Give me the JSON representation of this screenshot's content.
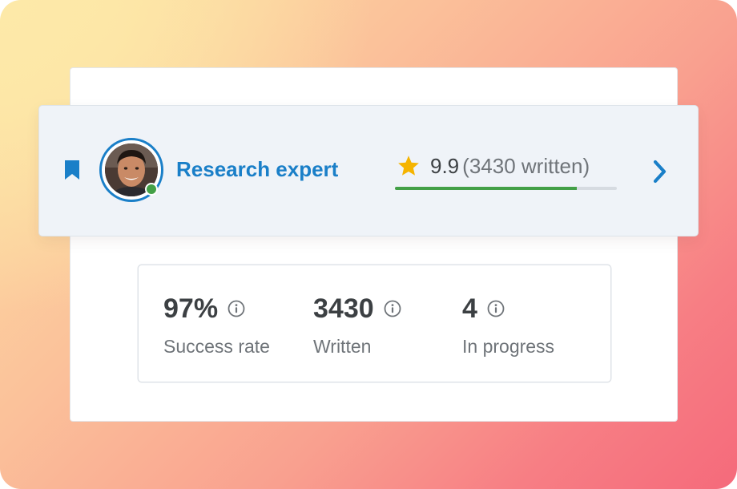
{
  "expert": {
    "title": "Research expert",
    "online": true
  },
  "rating": {
    "score": "9.9",
    "count_text": "(3430 written)",
    "progress_fraction": 0.82
  },
  "stats": [
    {
      "value": "97%",
      "label": "Success rate"
    },
    {
      "value": "3430",
      "label": "Written"
    },
    {
      "value": "4",
      "label": "In progress"
    }
  ],
  "colors": {
    "accent": "#1a7fc8",
    "success": "#43a047",
    "star": "#f5b400",
    "text_dark": "#3c4043",
    "text_muted": "#6f7479"
  },
  "icons": {
    "bookmark": "bookmark-icon",
    "star": "star-icon",
    "info": "info-icon",
    "next": "chevron-right-icon",
    "online": "online-status-dot"
  }
}
